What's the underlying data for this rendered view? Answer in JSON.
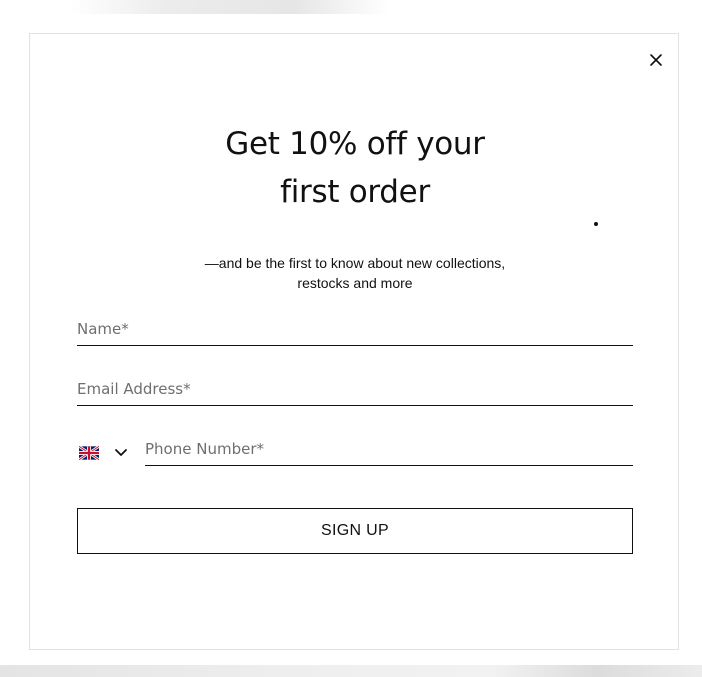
{
  "modal": {
    "title_line1": "Get 10% off your",
    "title_line2": "first order",
    "subtitle_line1": "—and be the first to know about new collections,",
    "subtitle_line2": "restocks and more",
    "close_icon": "close-icon"
  },
  "form": {
    "name": {
      "placeholder": "Name*",
      "value": ""
    },
    "email": {
      "placeholder": "Email Address*",
      "value": ""
    },
    "phone": {
      "placeholder": "Phone Number*",
      "value": "",
      "country_flag": "uk-flag-icon",
      "dropdown_icon": "chevron-down-icon"
    },
    "submit_label": "SIGN UP"
  },
  "colors": {
    "text": "#111111",
    "placeholder": "#6f6f6f",
    "border": "#111111",
    "modal_border": "#e2e2e2",
    "background": "#ffffff"
  }
}
